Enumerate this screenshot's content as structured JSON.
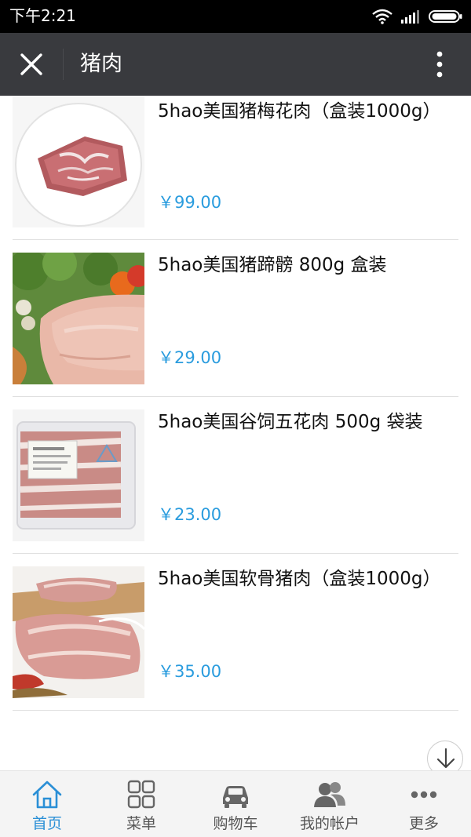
{
  "status_bar": {
    "time": "下午2:21"
  },
  "header": {
    "title": "猪肉"
  },
  "products": [
    {
      "name": "5hao美国猪梅花肉（盒装1000g）",
      "price": "￥99.00"
    },
    {
      "name": "5hao美国猪蹄髈 800g 盒装",
      "price": "￥29.00"
    },
    {
      "name": "5hao美国谷饲五花肉 500g 袋装",
      "price": "￥23.00"
    },
    {
      "name": "5hao美国软骨猪肉（盒装1000g）",
      "price": "￥35.00"
    }
  ],
  "nav": [
    {
      "label": "首页",
      "icon": "home-icon",
      "active": true
    },
    {
      "label": "菜单",
      "icon": "grid-icon",
      "active": false
    },
    {
      "label": "购物车",
      "icon": "car-icon",
      "active": false
    },
    {
      "label": "我的帐户",
      "icon": "users-icon",
      "active": false
    },
    {
      "label": "更多",
      "icon": "more-dots-icon",
      "active": false
    }
  ],
  "colors": {
    "accent": "#2a9cde",
    "title_bar": "#393a3e"
  }
}
